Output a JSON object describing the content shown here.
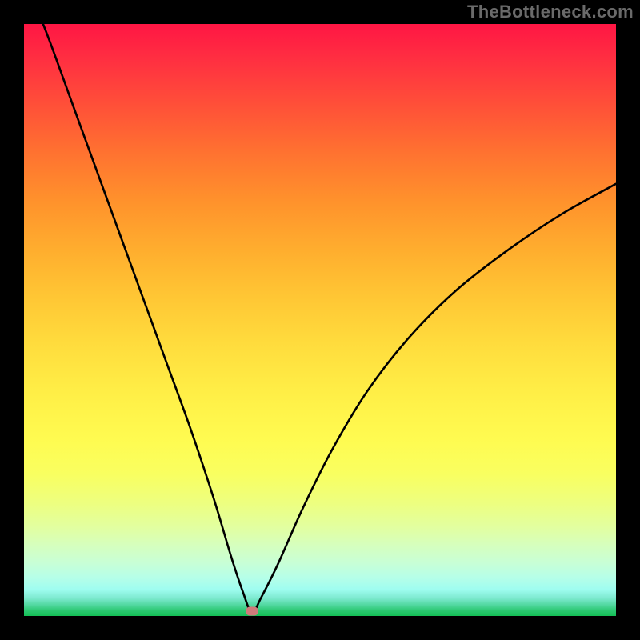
{
  "watermark": "TheBottleneck.com",
  "colors": {
    "frame": "#000000",
    "curve": "#000000",
    "marker": "#cf7b7b"
  },
  "chart_data": {
    "type": "line",
    "title": "",
    "xlabel": "",
    "ylabel": "",
    "xlim": [
      0,
      100
    ],
    "ylim": [
      0,
      100
    ],
    "grid": false,
    "annotations": [
      {
        "type": "marker",
        "x": 38.5,
        "y": 0.8,
        "shape": "rounded-rect",
        "color": "#cf7b7b"
      }
    ],
    "background_gradient": {
      "direction": "vertical",
      "stops": [
        {
          "value": 100,
          "color": "#ff1644"
        },
        {
          "value": 80,
          "color": "#ff922c"
        },
        {
          "value": 50,
          "color": "#ffdc3d"
        },
        {
          "value": 25,
          "color": "#f9ff60"
        },
        {
          "value": 10,
          "color": "#d6ffbd"
        },
        {
          "value": 0,
          "color": "#14bf56"
        }
      ]
    },
    "series": [
      {
        "name": "bottleneck-curve",
        "x": [
          0,
          4,
          8,
          12,
          16,
          20,
          24,
          28,
          32,
          35,
          37,
          38.5,
          40,
          43,
          47,
          52,
          58,
          65,
          73,
          82,
          91,
          100
        ],
        "values": [
          108,
          98,
          87,
          76,
          65,
          54,
          43,
          32,
          20,
          10,
          4,
          0.5,
          3,
          9,
          18,
          28,
          38,
          47,
          55,
          62,
          68,
          73
        ]
      }
    ]
  }
}
